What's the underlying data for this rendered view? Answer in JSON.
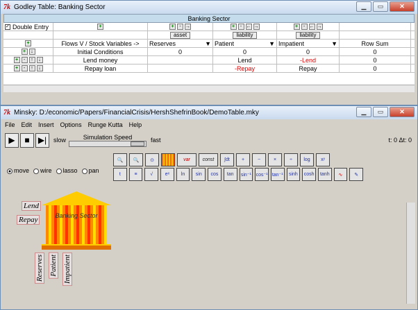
{
  "godley": {
    "title": "Godley Table: Banking Sector",
    "table_title": "Banking Sector",
    "double_entry": "Double Entry",
    "asset_btn": "asset",
    "liability_btn": "liability",
    "liability2_btn": "liability",
    "header": {
      "flows": "Flows V / Stock Variables ->",
      "c1": "Reserves",
      "c2": "Patient",
      "c3": "Impatient",
      "sum": "Row Sum"
    },
    "rows": [
      {
        "label": "Initial Conditions",
        "v1": "0",
        "v2": "0",
        "v3": "0",
        "sum": "0"
      },
      {
        "label": "Lend money",
        "v1": "",
        "v2": "Lend",
        "v3": "-Lend",
        "sum": "0"
      },
      {
        "label": "Repay loan",
        "v1": "",
        "v2": "-Repay",
        "v3": "Repay",
        "sum": "0"
      }
    ]
  },
  "minsky": {
    "title": "Minsky: D:/economic/Papers/FinancialCrisis/HershShefrinBook/DemoTable.mky",
    "menu": [
      "File",
      "Edit",
      "Insert",
      "Options",
      "Runge Kutta",
      "Help"
    ],
    "slow": "slow",
    "speed_label": "Simulation Speed",
    "fast": "fast",
    "time": "t: 0 Δt: 0",
    "modes": [
      "move",
      "wire",
      "lasso",
      "pan"
    ],
    "ops_row1": [
      "var",
      "const"
    ],
    "ops_row2": [
      "sin",
      "cos",
      "tan",
      "sin⁻¹",
      "cos⁻¹",
      "tan⁻¹",
      "sinh",
      "cosh",
      "tanh"
    ],
    "godley_icon_label": "Banking Sector",
    "flows": [
      "Lend",
      "Repay"
    ],
    "stocks": [
      "Reserves",
      "Patient",
      "Impatient"
    ]
  }
}
